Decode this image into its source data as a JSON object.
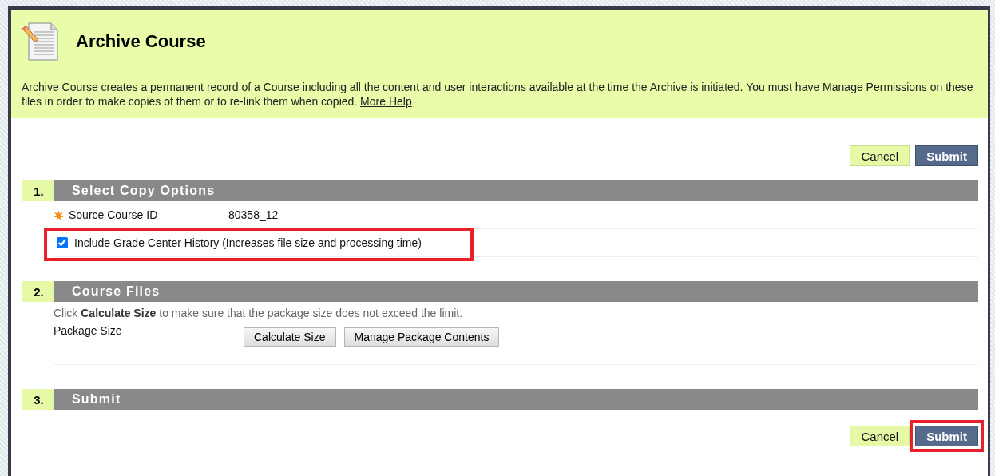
{
  "page": {
    "title": "Archive Course",
    "description": "Archive Course creates a permanent record of a Course including all the content and user interactions available at the time the Archive is initiated. You must have Manage Permissions on these files in order to make copies of them or to re-link them when copied.",
    "help_link": "More Help"
  },
  "top_buttons": [
    {
      "label": "Cancel",
      "kind": "cancel",
      "highlighted": false
    },
    {
      "label": "Submit",
      "kind": "submit",
      "highlighted": false
    }
  ],
  "sections": [
    {
      "number": "1.",
      "title": "Select Copy Options",
      "rows": [
        {
          "kind": "field",
          "required": true,
          "label": "Source Course ID",
          "value": "80358_12"
        },
        {
          "kind": "checkbox",
          "label": "Include Grade Center History (Increases file size and processing time)",
          "checked": true,
          "highlighted": true
        }
      ]
    },
    {
      "number": "2.",
      "title": "Course Files",
      "rows": [
        {
          "kind": "note",
          "text": "Click **Calculate Size** to make sure that the package size does not exceed the limit."
        },
        {
          "kind": "buttons",
          "label": "Package Size",
          "buttons": [
            "Calculate Size",
            "Manage Package Contents"
          ]
        }
      ]
    },
    {
      "number": "3.",
      "title": "Submit"
    }
  ],
  "bottom_buttons": [
    {
      "label": "Cancel",
      "kind": "cancel",
      "highlighted": false
    },
    {
      "label": "Submit",
      "kind": "submit",
      "highlighted": true
    }
  ]
}
